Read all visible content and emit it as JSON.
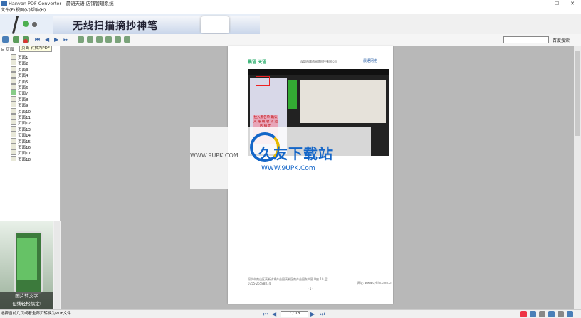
{
  "window": {
    "title": "Hanvon PDF Converter - 晨语天语 店铺管理系统",
    "minimize": "—",
    "maximize": "☐",
    "close": "✕"
  },
  "menu": {
    "items": [
      "文件(F)",
      "视图(V)",
      "帮助(H)"
    ]
  },
  "banner": {
    "text": "无线扫描摘抄神笔"
  },
  "toolbar": {
    "tooltip": "页面 转换为PDF",
    "search_button": "百度搜索",
    "search_value": ""
  },
  "tree": {
    "root_label": "页面",
    "pages": [
      "页面1",
      "页面2",
      "页面3",
      "页面4",
      "页面5",
      "页面6",
      "页面7",
      "页面8",
      "页面9",
      "页面10",
      "页面11",
      "页面12",
      "页面13",
      "页面14",
      "页面15",
      "页面16",
      "页面17",
      "页面18"
    ]
  },
  "preview": {
    "caption_line1": "图片转文字",
    "caption_line2": "在线轻松搞定!"
  },
  "document": {
    "logo_left": "晨语 天语",
    "company": "深圳市晨语网络科技有限公司",
    "logo_right": "晨语网络",
    "pink_text": "拉入黑名单 确认 入 账 确 收 货 运 店 铺 出",
    "footer_line1": "深圳市南山区高新技术产业园高新区南产业园东大厦 B座 10 层",
    "footer_line2": "0755-26588874",
    "footer_right": "网址: www.cyhhz.com.cn",
    "page_number": "- 1 -"
  },
  "watermark": {
    "brand": "久友下载站",
    "url_left": "WWW.9UPK.COM",
    "url_right": "WWW.9UPK.Com"
  },
  "status": {
    "text": "选择当前几页或者全部页转换为PDF文件",
    "page_field": "7 / 18"
  }
}
